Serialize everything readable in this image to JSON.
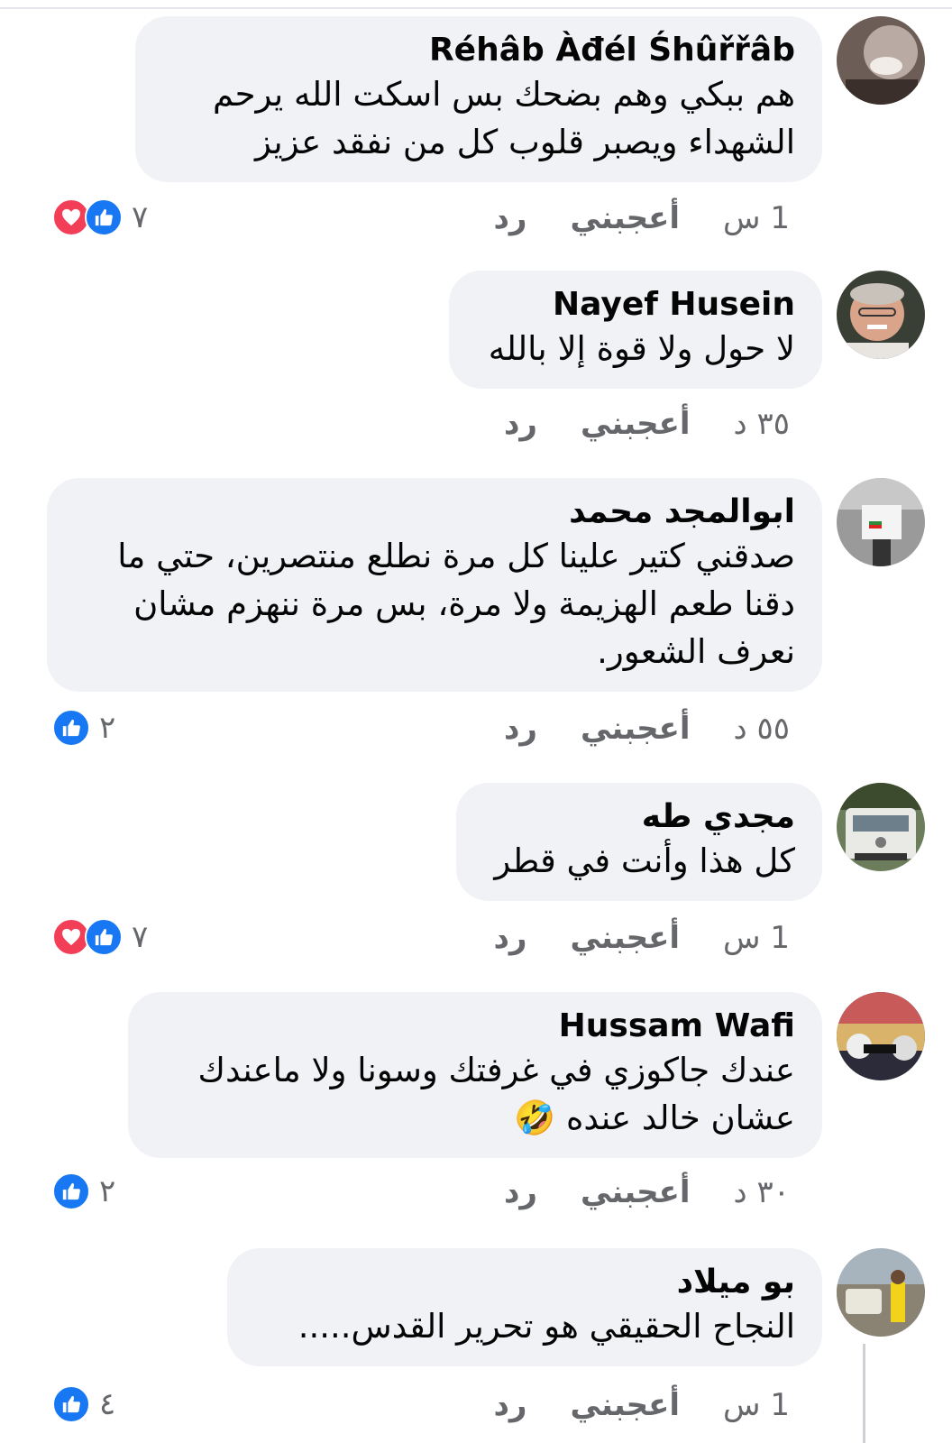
{
  "comments": [
    {
      "author": "Réhâb Àđél Śhûřřâb",
      "text": "هم ببكي وهم بضحك بس اسكت الله يرحم الشهداء ويصبر قلوب كل من نفقد عزيز",
      "time": "1 س",
      "like_label": "أعجبني",
      "reply_label": "رد",
      "reactions": [
        "heart-icon",
        "like-icon"
      ],
      "reaction_count": "٧"
    },
    {
      "author": "Nayef Husein",
      "text": "لا حول ولا قوة إلا بالله",
      "time": "٣٥ د",
      "like_label": "أعجبني",
      "reply_label": "رد"
    },
    {
      "author": "ابوالمجد محمد",
      "text": "صدقني كتير علينا كل مرة نطلع منتصرين، حتي ما دقنا طعم الهزيمة ولا مرة، بس مرة ننهزم مشان نعرف الشعور.",
      "time": "٥٥ د",
      "like_label": "أعجبني",
      "reply_label": "رد",
      "reactions": [
        "like-icon"
      ],
      "reaction_count": "٢"
    },
    {
      "author": "مجدي طه",
      "text": "كل هذا وأنت في قطر",
      "time": "1 س",
      "like_label": "أعجبني",
      "reply_label": "رد",
      "reactions": [
        "heart-icon",
        "like-icon"
      ],
      "reaction_count": "٧"
    },
    {
      "author": "Hussam Wafi",
      "text": "عندك جاكوزي في غرفتك وسونا ولا ماعندك عشان خالد عنده 🤣",
      "time": "٣٠ د",
      "like_label": "أعجبني",
      "reply_label": "رد",
      "reactions": [
        "like-icon"
      ],
      "reaction_count": "٢"
    },
    {
      "author": "بو ميلاد",
      "text": "النجاح الحقيقي هو تحرير القدس.....",
      "time": "1 س",
      "like_label": "أعجبني",
      "reply_label": "رد",
      "reactions": [
        "like-icon"
      ],
      "reaction_count": "٤"
    }
  ],
  "colors": {
    "bubble": "#f0f2f5",
    "like_blue": "#1877f2",
    "love_red": "#f33e58",
    "meta_gray": "#65676b"
  }
}
